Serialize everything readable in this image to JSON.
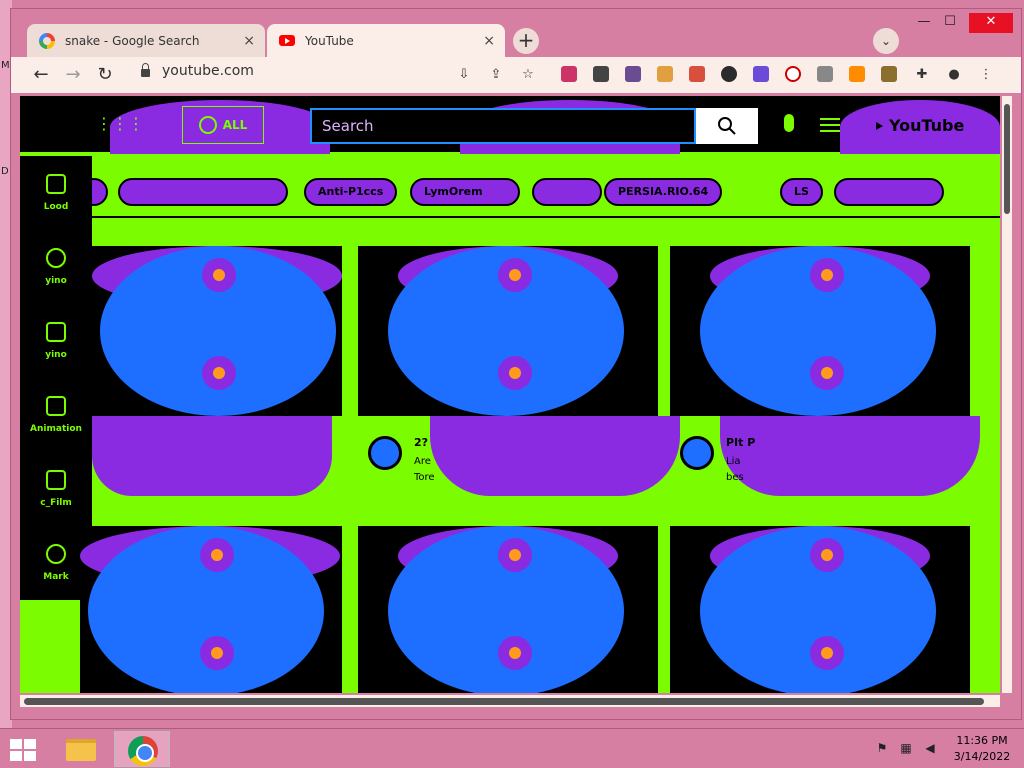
{
  "desktop": {
    "left_labels": [
      "M",
      "D"
    ]
  },
  "tabs": [
    {
      "title": "snake - Google Search",
      "close": "×"
    },
    {
      "title": "YouTube",
      "close": "×"
    }
  ],
  "tabstrip": {
    "new_tab": "+",
    "tab_search": "⌄"
  },
  "window_controls": {
    "minimize": "—",
    "maximize": "☐",
    "close": "✕"
  },
  "toolbar": {
    "back": "←",
    "forward": "→",
    "reload": "↻",
    "url": "youtube.com",
    "install": "⇩",
    "share": "⇪",
    "bookmark": "☆",
    "extensions": "✚",
    "profile": "●",
    "menu": "⋮"
  },
  "extension_colors": [
    "#cc3366",
    "#444444",
    "#6a4c93",
    "#e0a040",
    "#d94f3d",
    "#2b2b2b",
    "#6b4bd8",
    "#ffffff",
    "#888888",
    "#ff8c00",
    "#8b6f2f"
  ],
  "youtube": {
    "all_label": "ALL",
    "search_placeholder": "Search",
    "logo": "YouTube",
    "chips": [
      "",
      "",
      "Anti-P1ccs",
      "LymOrem",
      "",
      "PERSIA.RIO.64",
      "LS",
      ""
    ],
    "sidebar": [
      {
        "label": "Lood"
      },
      {
        "label": "yino"
      },
      {
        "label": "yino"
      },
      {
        "label": "Animation"
      },
      {
        "label": "c_Film"
      },
      {
        "label": "Mark"
      }
    ],
    "videos": [
      {
        "title": "",
        "line1": "",
        "line2": ""
      },
      {
        "title": "2?",
        "line1": "Are",
        "line2": "Tore"
      },
      {
        "title": "PIt P",
        "line1": "Lia",
        "line2": "bes"
      }
    ]
  },
  "colors": {
    "accent_green": "#7cfc00",
    "purple": "#8a2be2",
    "blue": "#1e6eff",
    "orange": "#ff9a1e"
  },
  "taskbar": {
    "time": "11:36 PM",
    "date": "3/14/2022"
  }
}
